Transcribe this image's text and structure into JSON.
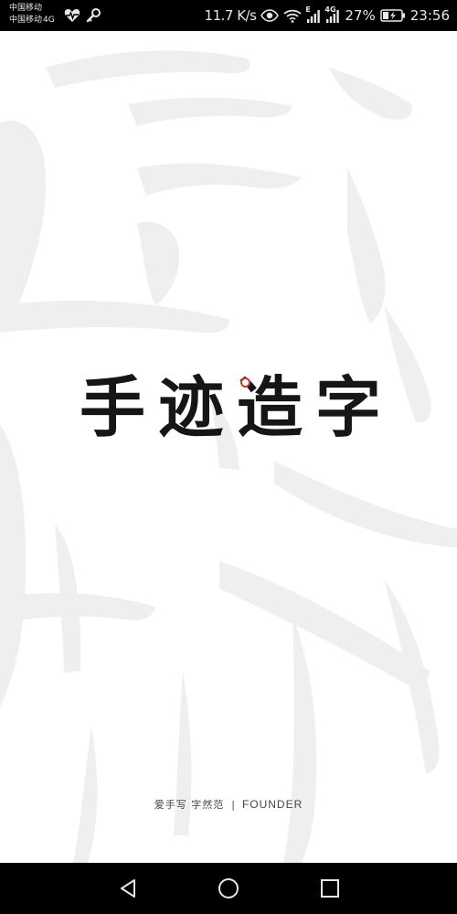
{
  "status_bar": {
    "carrier_1": "中国移动",
    "carrier_2": "中国移动",
    "carrier_2_net": "4G",
    "net_speed": "11.7 K/s",
    "signal_1_type": "E",
    "signal_2_type": "4G",
    "battery_percent": "27%",
    "time": "23:56",
    "icons": [
      "health-heart-icon",
      "key-icon",
      "eye-icon",
      "wifi-icon",
      "signal-icon",
      "battery-charging-icon"
    ]
  },
  "splash": {
    "logo_chars": [
      "手",
      "迹",
      "造",
      "字"
    ],
    "slogan": "爱手写 字然范",
    "separator": "|",
    "brand": "FOUNDER",
    "accent_color": "#c0392b"
  },
  "nav_bar": {
    "icons": [
      "back-icon",
      "home-icon",
      "recents-icon"
    ]
  }
}
